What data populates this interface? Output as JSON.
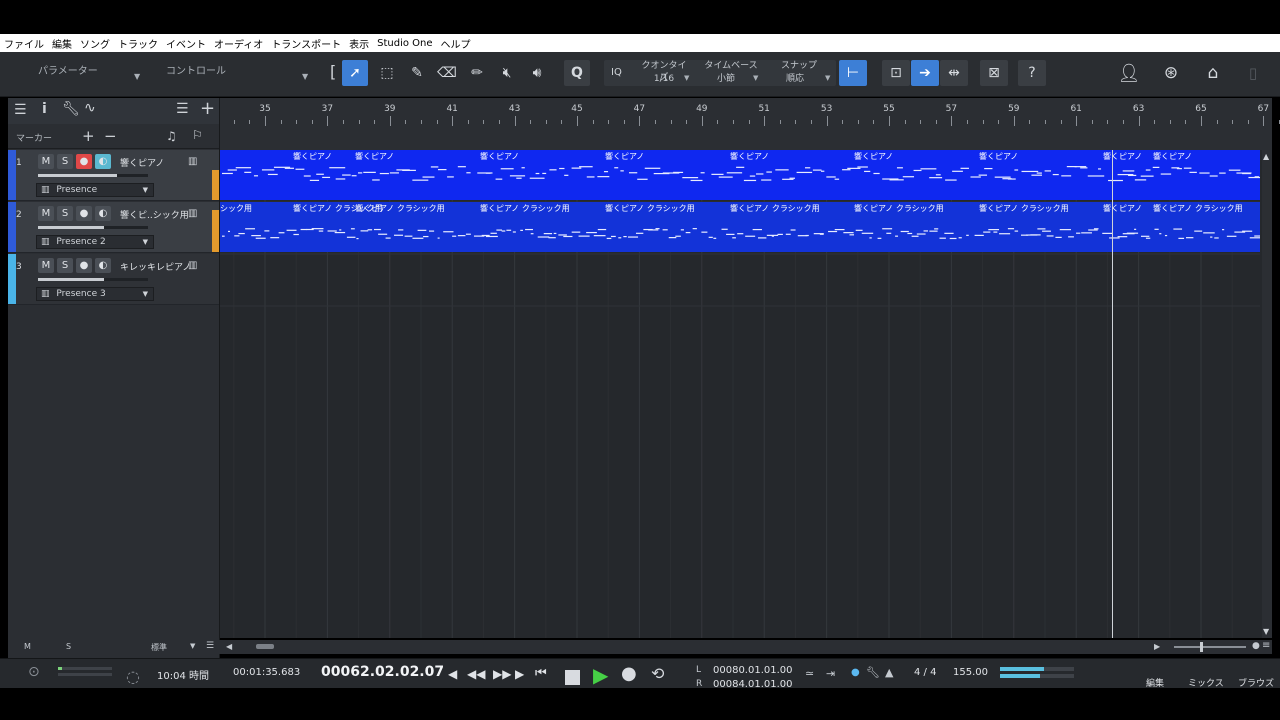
{
  "menu": [
    "ファイル",
    "編集",
    "ソング",
    "トラック",
    "イベント",
    "オーディオ",
    "トランスポート",
    "表示",
    "Studio One",
    "ヘルプ"
  ],
  "toolbar": {
    "parameter_label": "パラメーター",
    "control_label": "コントロール",
    "quantize_label": "クオンタイズ",
    "quantize_value": "1/16",
    "timebase_label": "タイムベース",
    "timebase_value": "小節",
    "snap_label": "スナップ",
    "snap_value": "順応",
    "iq_label": "IQ",
    "help_label": "?"
  },
  "left_panel": {
    "marker_label": "マーカー",
    "bottom_m": "M",
    "bottom_s": "S",
    "bottom_view": "標準"
  },
  "tracks": [
    {
      "number": "1",
      "name": "響くピアノ",
      "instrument": "Presence",
      "color": "#2f5bd9",
      "mute": "M",
      "solo": "S",
      "rec_on": true,
      "mon_on": true,
      "volume": 0.72
    },
    {
      "number": "2",
      "name": "響くピ..シック用",
      "instrument": "Presence 2",
      "color": "#2f5bd9",
      "mute": "M",
      "solo": "S",
      "rec_on": false,
      "mon_on": false,
      "volume": 0.6
    },
    {
      "number": "3",
      "name": "キレッキレピアノ",
      "instrument": "Presence 3",
      "color": "#4ab4e8",
      "mute": "M",
      "solo": "S",
      "rec_on": false,
      "mon_on": false,
      "volume": 0.6
    }
  ],
  "ruler": {
    "bars": [
      "35",
      "37",
      "39",
      "41",
      "43",
      "45",
      "47",
      "49",
      "51",
      "53",
      "55",
      "57",
      "59",
      "61",
      "63",
      "65",
      "67"
    ]
  },
  "lane1_events": [
    "響くピアノ",
    "響くピアノ",
    "響くピアノ",
    "響くピアノ",
    "響くピアノ",
    "響くピアノ",
    "響くピアノ",
    "響くピアノ",
    "響くピアノ"
  ],
  "lane2_events": [
    "シック用",
    "響くピアノ クラシック用",
    "響くピアノ クラシック用",
    "響くピアノ クラシック用",
    "響くピアノ クラシック用",
    "響くピアノ クラシック用",
    "響くピアノ クラシック用",
    "響くピアノ クラシック用",
    "響くピアノ",
    "響くピアノ クラシック用"
  ],
  "transport": {
    "clock_time": "10:04 時間",
    "elapsed": "00:01:35.683",
    "position": "00062.02.02.07",
    "loop_l": "00080.01.01.00",
    "loop_r": "00084.01.01.00",
    "l_label": "L",
    "r_label": "R",
    "signature": "4 / 4",
    "tempo": "155.00",
    "page_edit": "編集",
    "page_mix": "ミックス",
    "page_browse": "ブラウズ"
  },
  "colors": {
    "accent": "#3d7fd6",
    "event_blue": "#0f28f0",
    "record": "#e04848",
    "monitor": "#5bb8d0",
    "orange": "#e39a2d"
  }
}
